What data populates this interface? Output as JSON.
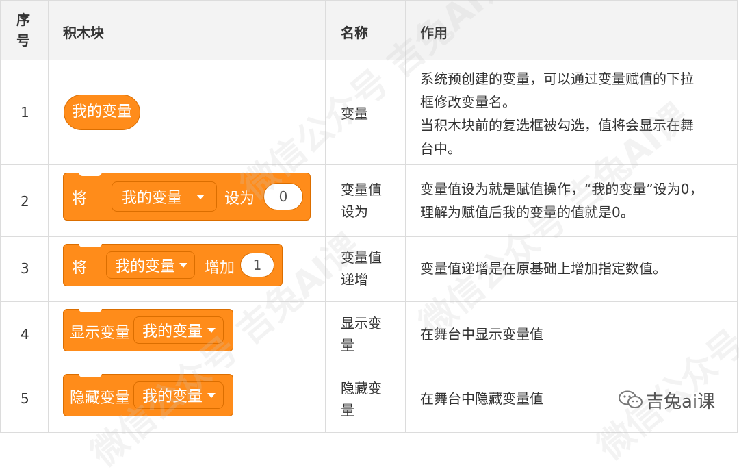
{
  "header": {
    "col1": "序号",
    "col2": "积木块",
    "col3": "名称",
    "col4": "作用"
  },
  "rows": [
    {
      "index": "1",
      "block": {
        "type": "reporter",
        "label": "我的变量"
      },
      "name": "变量",
      "desc": "系统预创建的变量，可以通过变量赋值的下拉框修改变量名。当积木块前的复选框被勾选，值将会显示在舞台中。",
      "desc_lines": [
        "系统预创建的变量，可以通过变量赋值的下拉",
        "框修改变量名。",
        "当积木块前的复选框被勾选，值将会显示在舞",
        "台中。"
      ]
    },
    {
      "index": "2",
      "block": {
        "type": "stack",
        "prefix": "将",
        "dropdown": "我的变量",
        "middle": "设为",
        "value": "0"
      },
      "name_lines": [
        "变量值",
        "设为"
      ],
      "desc_lines": [
        "变量值设为就是赋值操作，“我的变量”设为0，",
        "理解为赋值后我的变量的值就是0。"
      ]
    },
    {
      "index": "3",
      "block": {
        "type": "stack",
        "prefix": "将",
        "dropdown": "我的变量",
        "middle": "增加",
        "value": "1"
      },
      "name_lines": [
        "变量值",
        "递增"
      ],
      "desc_lines": [
        "变量值递增是在原基础上增加指定数值。"
      ]
    },
    {
      "index": "4",
      "block": {
        "type": "stack",
        "prefix": "显示变量",
        "dropdown": "我的变量"
      },
      "name_lines": [
        "显示变",
        "量"
      ],
      "desc_lines": [
        "在舞台中显示变量值"
      ]
    },
    {
      "index": "5",
      "block": {
        "type": "stack",
        "prefix": "隐藏变量",
        "dropdown": "我的变量"
      },
      "name_lines": [
        "隐藏变",
        "量"
      ],
      "desc_lines": [
        "在舞台中隐藏变量值"
      ]
    }
  ],
  "watermark": "微信公众号 吉兔AI课",
  "signature": "吉兔ai课",
  "colors": {
    "block": "#ff8c1a",
    "block_border": "#db6e00",
    "header_bg": "#f3f3f3",
    "grid": "#dcdcdc"
  }
}
